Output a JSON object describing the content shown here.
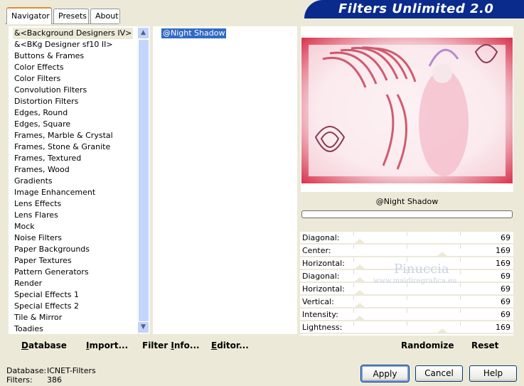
{
  "tabs": [
    {
      "label": "Navigator",
      "active": true
    },
    {
      "label": "Presets",
      "active": false
    },
    {
      "label": "About",
      "active": false
    }
  ],
  "banner": {
    "title": "Filters Unlimited 2.0"
  },
  "categories": [
    "&<Background Designers IV>",
    "&<BKg Designer sf10 II>",
    "Buttons & Frames",
    "Color Effects",
    "Color Filters",
    "Convolution Filters",
    "Distortion Filters",
    "Edges, Round",
    "Edges, Square",
    "Frames, Marble & Crystal",
    "Frames, Stone & Granite",
    "Frames, Textured",
    "Frames, Wood",
    "Gradients",
    "Image Enhancement",
    "Lens Effects",
    "Lens Flares",
    "Mock",
    "Noise Filters",
    "Paper Backgrounds",
    "Paper Textures",
    "Pattern Generators",
    "Render",
    "Special Effects 1",
    "Special Effects 2",
    "Tile & Mirror",
    "Toadies"
  ],
  "filters": [
    "@Night Shadow"
  ],
  "preview": {
    "filter_name": "@Night Shadow",
    "progress": 0
  },
  "sliders": [
    {
      "label": "Diagonal:",
      "value": "69"
    },
    {
      "label": "Center:",
      "value": "169"
    },
    {
      "label": "Horizontal:",
      "value": "169"
    },
    {
      "label": "Diagonal:",
      "value": "69"
    },
    {
      "label": "Horizontal:",
      "value": "69"
    },
    {
      "label": "Vertical:",
      "value": "69"
    },
    {
      "label": "Intensity:",
      "value": "69"
    },
    {
      "label": "Lightness:",
      "value": "169"
    }
  ],
  "actions": {
    "database": {
      "mnemonic": "D",
      "rest": "atabase"
    },
    "import": {
      "mnemonic": "I",
      "rest": "mport..."
    },
    "filter_info": {
      "pre": "Filter ",
      "mnemonic": "I",
      "rest": "nfo..."
    },
    "editor": {
      "mnemonic": "E",
      "rest": "ditor..."
    },
    "randomize": "Randomize",
    "reset": "Reset"
  },
  "status": {
    "database_label": "Database:",
    "database_value": "ICNET-Filters",
    "filters_label": "Filters:",
    "filters_value": "386"
  },
  "buttons": {
    "apply": "Apply",
    "cancel": "Cancel",
    "help": "Help"
  },
  "watermark": {
    "name": "Pinuccia",
    "url": "www.maidiregrafica.eu"
  },
  "colors": {
    "banner": "#0a2a8c",
    "selection": "#316ac5",
    "tab_accent": "#e68b2c"
  }
}
